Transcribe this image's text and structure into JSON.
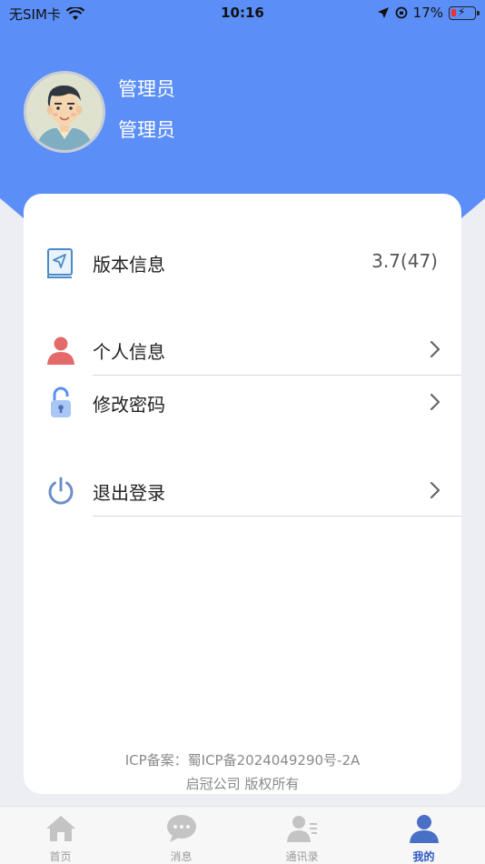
{
  "status_bar": {
    "carrier": "无SIM卡",
    "time": "10:16",
    "battery": "17%"
  },
  "profile": {
    "name": "管理员",
    "role": "管理员"
  },
  "menu": {
    "version_label": "版本信息",
    "version_value": "3.7(47)",
    "personal_info_label": "个人信息",
    "change_password_label": "修改密码",
    "logout_label": "退出登录"
  },
  "footer": {
    "icp": "ICP备案：蜀ICP备2024049290号-2A",
    "copyright": "启冠公司 版权所有"
  },
  "tabbar": {
    "tabs": [
      {
        "label": "首页",
        "icon": "home-icon"
      },
      {
        "label": "消息",
        "icon": "message-icon"
      },
      {
        "label": "通讯录",
        "icon": "contacts-icon"
      },
      {
        "label": "我的",
        "icon": "profile-icon"
      }
    ],
    "active_index": 3
  },
  "colors": {
    "header": "#5b8ff7",
    "accent": "#2a56c6",
    "background": "#eceef3",
    "card": "#ffffff"
  }
}
